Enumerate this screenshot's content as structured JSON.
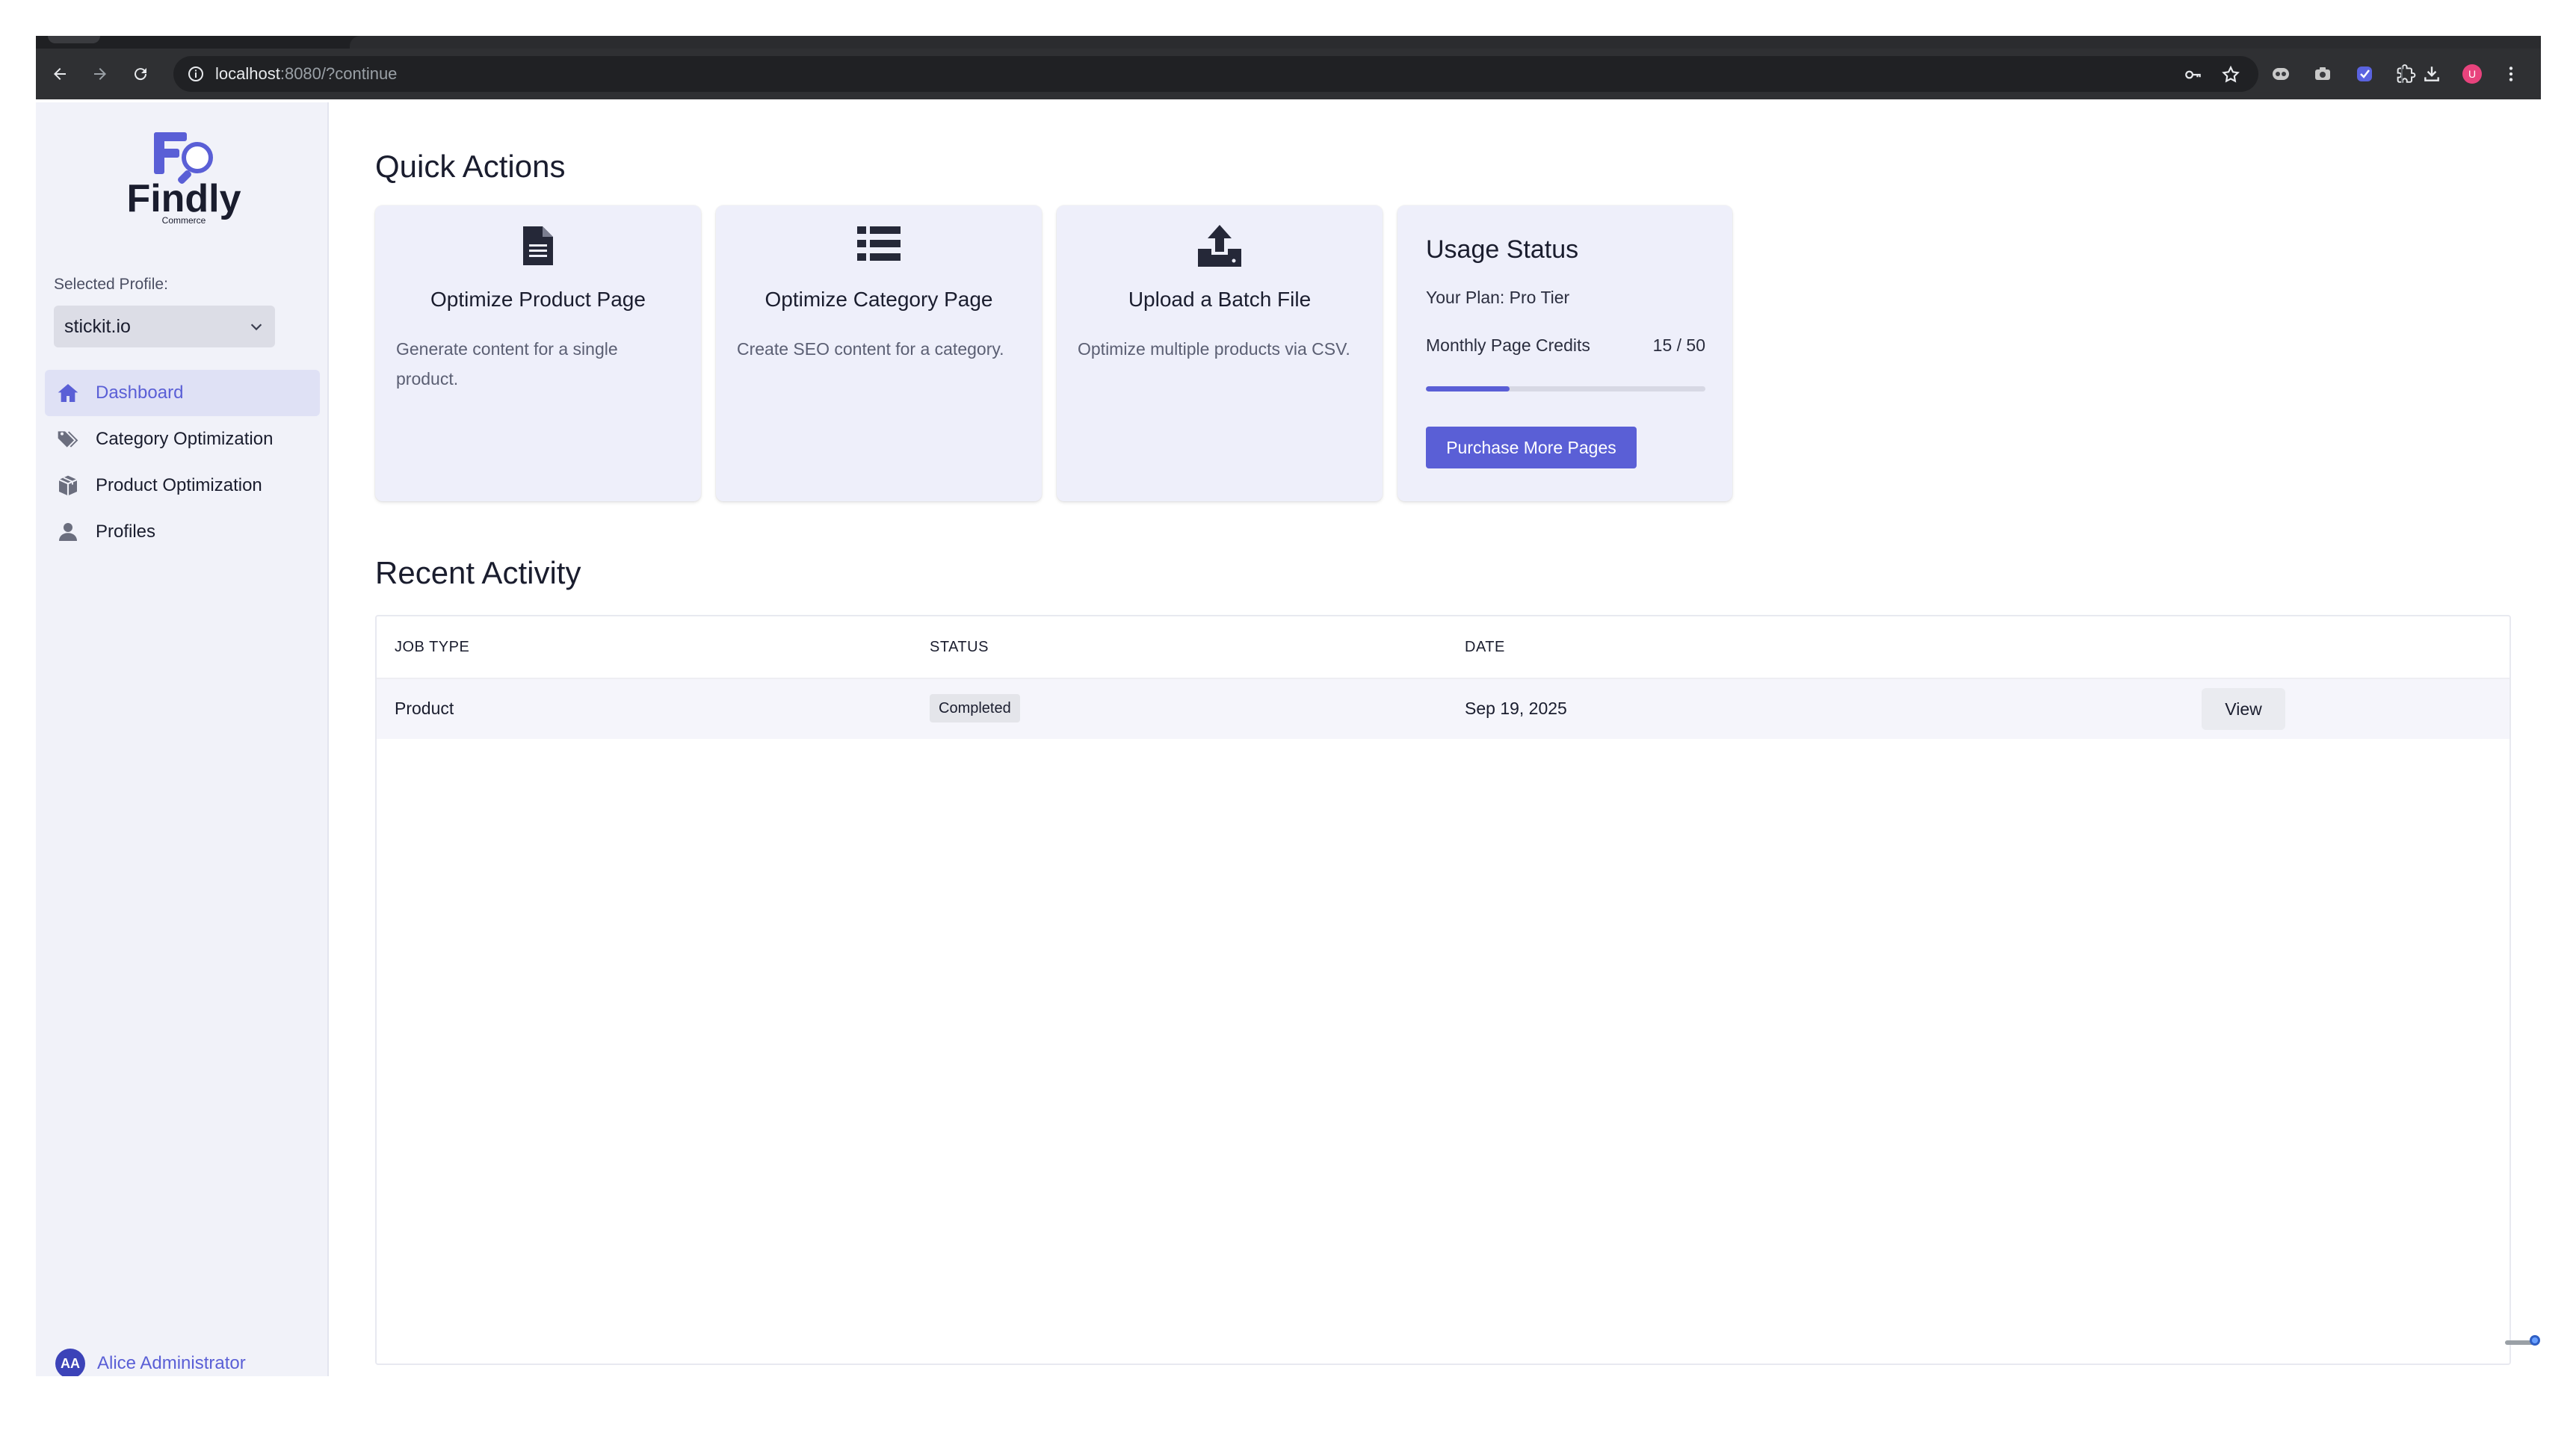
{
  "browser": {
    "url_host": "localhost",
    "url_rest": ":8080/?continue",
    "profile_initial": "U"
  },
  "colors": {
    "accent": "#5a5fd6",
    "sidebar_bg": "#f1f2f9",
    "card_bg": "#eeeffa"
  },
  "sidebar": {
    "logo_text": "Findly",
    "logo_sub": "Commerce",
    "profile_label": "Selected Profile:",
    "profile_value": "stickit.io",
    "items": [
      {
        "label": "Dashboard",
        "icon": "home-icon",
        "active": true
      },
      {
        "label": "Category Optimization",
        "icon": "tags-icon",
        "active": false
      },
      {
        "label": "Product Optimization",
        "icon": "box-icon",
        "active": false
      },
      {
        "label": "Profiles",
        "icon": "user-icon",
        "active": false
      }
    ],
    "user": {
      "initials": "AA",
      "name": "Alice Administrator"
    }
  },
  "quick_actions": {
    "title": "Quick Actions",
    "cards": [
      {
        "title": "Optimize Product Page",
        "desc": "Generate content for a single product.",
        "icon": "document-icon"
      },
      {
        "title": "Optimize Category Page",
        "desc": "Create SEO content for a category.",
        "icon": "list-icon"
      },
      {
        "title": "Upload a Batch File",
        "desc": "Optimize multiple products via CSV.",
        "icon": "upload-icon"
      }
    ]
  },
  "usage": {
    "title": "Usage Status",
    "plan": "Your Plan: Pro Tier",
    "credits_label": "Monthly Page Credits",
    "credits_value": "15 / 50",
    "progress_fraction": 0.3,
    "button": "Purchase More Pages"
  },
  "recent": {
    "title": "Recent Activity",
    "columns": [
      "JOB TYPE",
      "STATUS",
      "DATE"
    ],
    "rows": [
      {
        "job_type": "Product",
        "status": "Completed",
        "date": "Sep 19, 2025",
        "action": "View"
      }
    ]
  }
}
